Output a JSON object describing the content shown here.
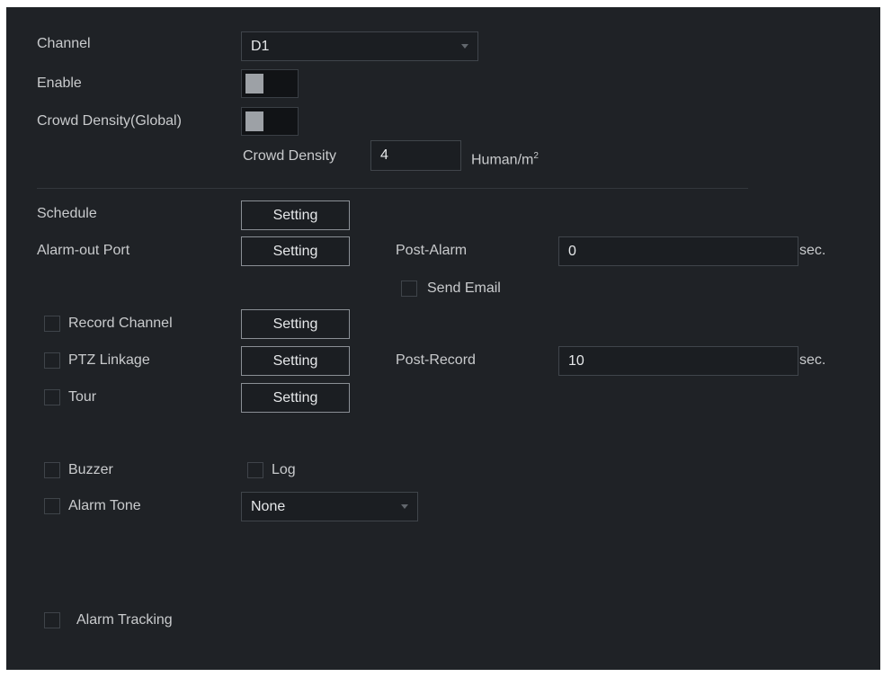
{
  "channel": {
    "label": "Channel",
    "value": "D1"
  },
  "enable": {
    "label": "Enable"
  },
  "crowd_density_global": {
    "label": "Crowd Density(Global)"
  },
  "crowd_density": {
    "label": "Crowd Density",
    "value": "4",
    "unit": "Human/m",
    "unit_sup": "2"
  },
  "schedule": {
    "label": "Schedule",
    "button": "Setting"
  },
  "alarm_out_port": {
    "label": "Alarm-out Port",
    "button": "Setting"
  },
  "post_alarm": {
    "label": "Post-Alarm",
    "value": "0",
    "unit": "sec."
  },
  "send_email": {
    "label": "Send Email"
  },
  "record_channel": {
    "label": "Record Channel",
    "button": "Setting"
  },
  "ptz_linkage": {
    "label": "PTZ Linkage",
    "button": "Setting"
  },
  "post_record": {
    "label": "Post-Record",
    "value": "10",
    "unit": "sec."
  },
  "tour": {
    "label": "Tour",
    "button": "Setting"
  },
  "buzzer": {
    "label": "Buzzer"
  },
  "log": {
    "label": "Log"
  },
  "alarm_tone": {
    "label": "Alarm Tone",
    "value": "None"
  },
  "alarm_tracking": {
    "label": "Alarm Tracking"
  }
}
